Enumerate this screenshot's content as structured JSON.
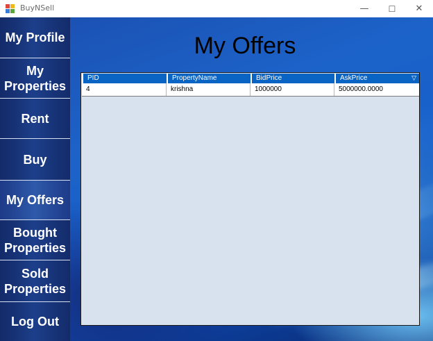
{
  "window": {
    "title": "BuyNSell",
    "controls": {
      "minimize": "—",
      "maximize": "☐",
      "close": "✕"
    }
  },
  "sidebar": {
    "items": [
      {
        "label": "My Profile"
      },
      {
        "label": "My Properties"
      },
      {
        "label": "Rent"
      },
      {
        "label": "Buy"
      },
      {
        "label": "My Offers"
      },
      {
        "label": "Bought Properties"
      },
      {
        "label": "Sold Properties"
      },
      {
        "label": "Log Out"
      }
    ]
  },
  "main": {
    "title": "My Offers",
    "grid": {
      "columns": [
        "PID",
        "PropertyName",
        "BidPrice",
        "AskPrice"
      ],
      "sort_icon": "▽",
      "rows": [
        {
          "pid": "4",
          "property_name": "krishna",
          "bid_price": "1000000",
          "ask_price": "5000000.0000"
        }
      ]
    }
  },
  "colors": {
    "grid_header": "#0a64c4",
    "grid_background": "#d8e2ef",
    "sidebar": "#102a66"
  },
  "icons": {
    "app": "app-icon",
    "sort": "sort-triangle-icon"
  }
}
